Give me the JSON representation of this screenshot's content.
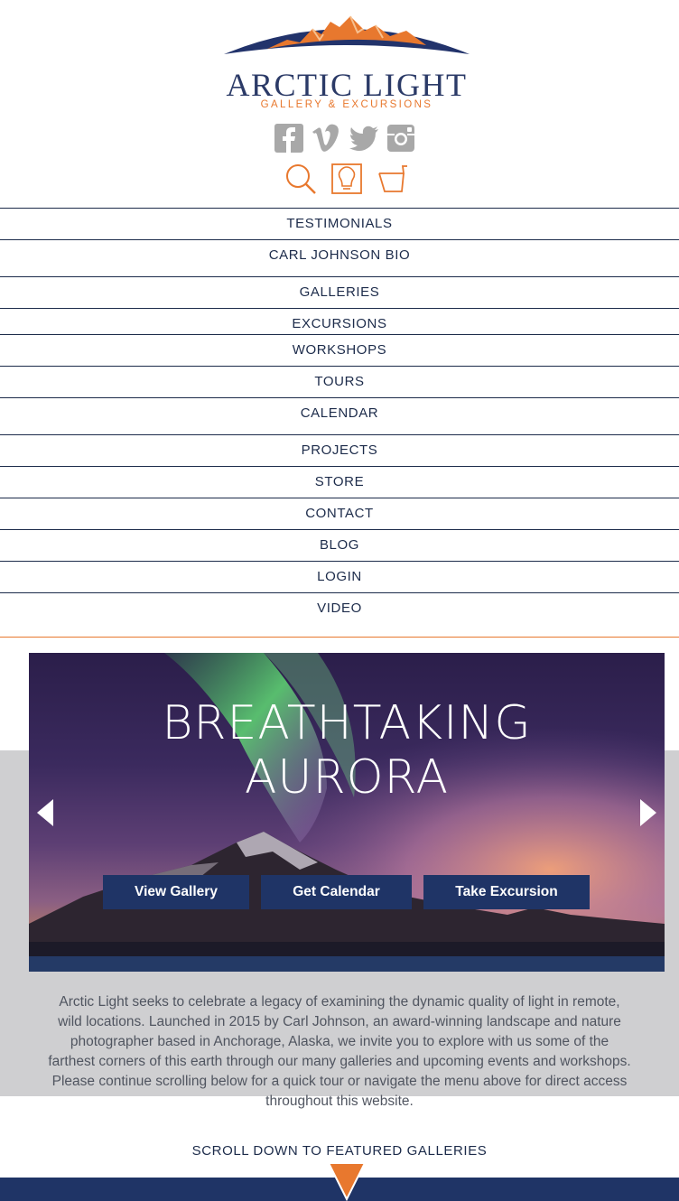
{
  "brand": {
    "name": "ARCTIC LIGHT",
    "tagline": "GALLERY & EXCURSIONS",
    "colors": {
      "navy": "#1f3466",
      "orange": "#e8782e",
      "grey": "#cfcfd1"
    }
  },
  "social": [
    "facebook-icon",
    "vimeo-icon",
    "twitter-icon",
    "instagram-icon"
  ],
  "utility": [
    "search-icon",
    "lightbulb-icon",
    "cart-icon"
  ],
  "nav": [
    "TESTIMONIALS",
    "CARL JOHNSON BIO",
    "GALLERIES",
    "EXCURSIONS",
    "WORKSHOPS",
    "TOURS",
    "CALENDAR",
    "PROJECTS",
    "STORE",
    "CONTACT",
    "BLOG",
    "LOGIN",
    "VIDEO"
  ],
  "hero": {
    "title_line1": "BREATHTAKING",
    "title_line2": "AURORA",
    "buttons": [
      "View Gallery",
      "Get Calendar",
      "Take Excursion"
    ]
  },
  "intro": "Arctic Light seeks to celebrate a legacy of examining the dynamic quality of light in remote, wild locations. Launched in 2015 by Carl Johnson, an award-winning landscape and nature photographer based in Anchorage, Alaska, we invite you to explore with us some of the farthest corners of this earth through our many galleries and upcoming events and workshops. Please continue scrolling below for a quick tour or navigate the menu above for direct access throughout this website.",
  "scroll_label": "SCROLL DOWN TO FEATURED GALLERIES"
}
